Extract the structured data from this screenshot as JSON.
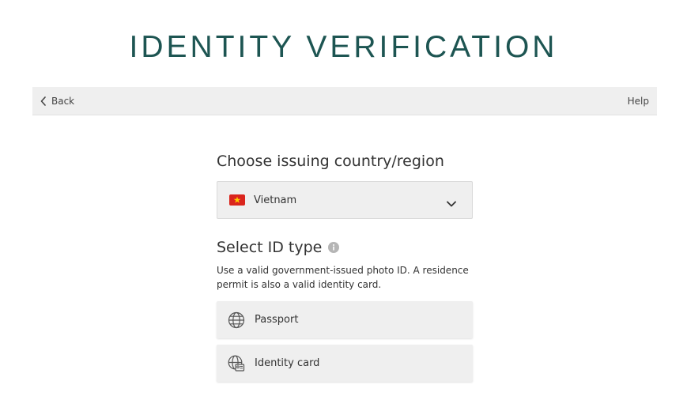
{
  "header": {
    "title": "IDENTITY VERIFICATION"
  },
  "nav": {
    "back_label": "Back",
    "help_label": "Help",
    "back_icon": "chevron-left-icon"
  },
  "country_section": {
    "heading": "Choose issuing country/region",
    "selected_country": "Vietnam",
    "flag_icon": "vietnam-flag-icon",
    "dropdown_icon": "chevron-down-icon"
  },
  "id_section": {
    "heading": "Select ID type",
    "info_icon": "info-icon",
    "hint": "Use a valid government-issued photo ID. A residence permit is also a valid identity card.",
    "options": [
      {
        "label": "Passport",
        "icon": "globe-icon"
      },
      {
        "label": "Identity card",
        "icon": "id-card-icon"
      }
    ]
  },
  "colors": {
    "title": "#1d5552",
    "navbar_bg": "#efefef",
    "option_bg": "#efefef",
    "flag_red": "#da251d",
    "flag_star": "#ffcd00"
  }
}
